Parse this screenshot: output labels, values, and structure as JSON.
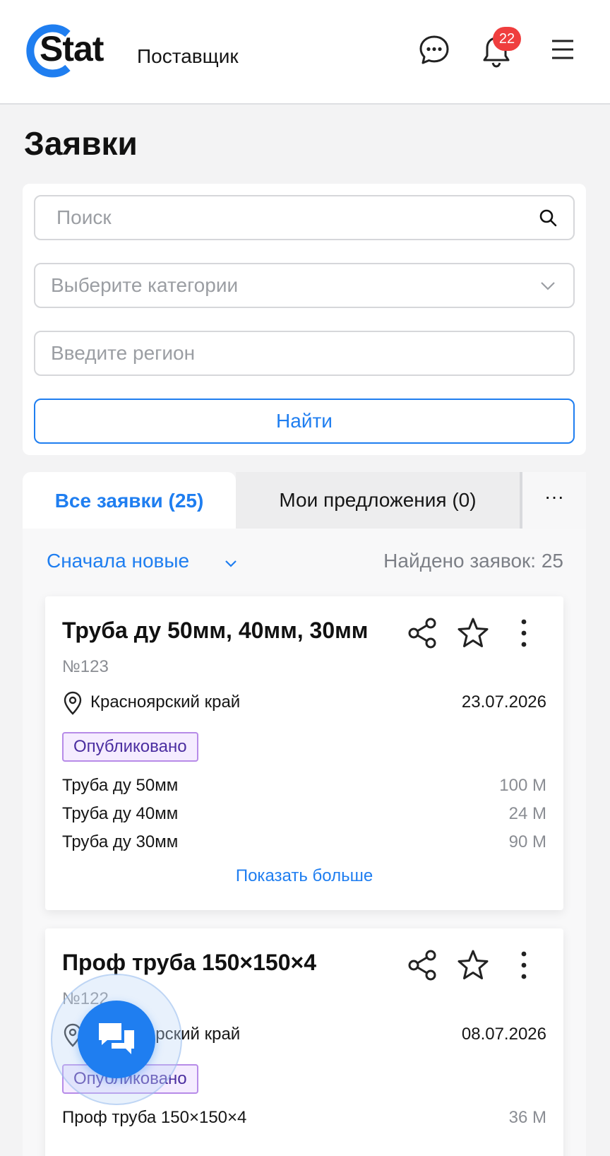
{
  "header": {
    "logo_text": "Stat",
    "role": "Поставщик",
    "notification_count": "22"
  },
  "page": {
    "title": "Заявки"
  },
  "filters": {
    "search_placeholder": "Поиск",
    "category_placeholder": "Выберите категории",
    "region_placeholder": "Введите регион",
    "find_label": "Найти"
  },
  "tabs": [
    {
      "label": "Все заявки (25)",
      "active": true
    },
    {
      "label": "Мои предложения (0)",
      "active": false
    },
    {
      "label": "···",
      "active": false
    }
  ],
  "list": {
    "sort_label": "Сначала новые",
    "found_label": "Найдено заявок: 25"
  },
  "requests": [
    {
      "title": "Труба ду 50мм, 40мм, 30мм",
      "number": "№123",
      "region": "Красноярский край",
      "date": "23.07.2026",
      "status": "Опубликовано",
      "items": [
        {
          "name": "Труба ду 50мм",
          "qty": "100 М"
        },
        {
          "name": "Труба ду 40мм",
          "qty": "24 М"
        },
        {
          "name": "Труба ду 30мм",
          "qty": "90 М"
        }
      ],
      "show_more": "Показать больше"
    },
    {
      "title": "Проф труба 150×150×4",
      "number": "№122",
      "region": "Красноярский край",
      "date": "08.07.2026",
      "status": "Опубликовано",
      "items": [
        {
          "name": "Проф труба 150×150×4",
          "qty": "36 М"
        }
      ]
    }
  ],
  "colors": {
    "accent": "#1f7ef0",
    "badge": "#ef3e3e",
    "status_border": "#b78be8",
    "status_bg": "#f5ecff"
  }
}
